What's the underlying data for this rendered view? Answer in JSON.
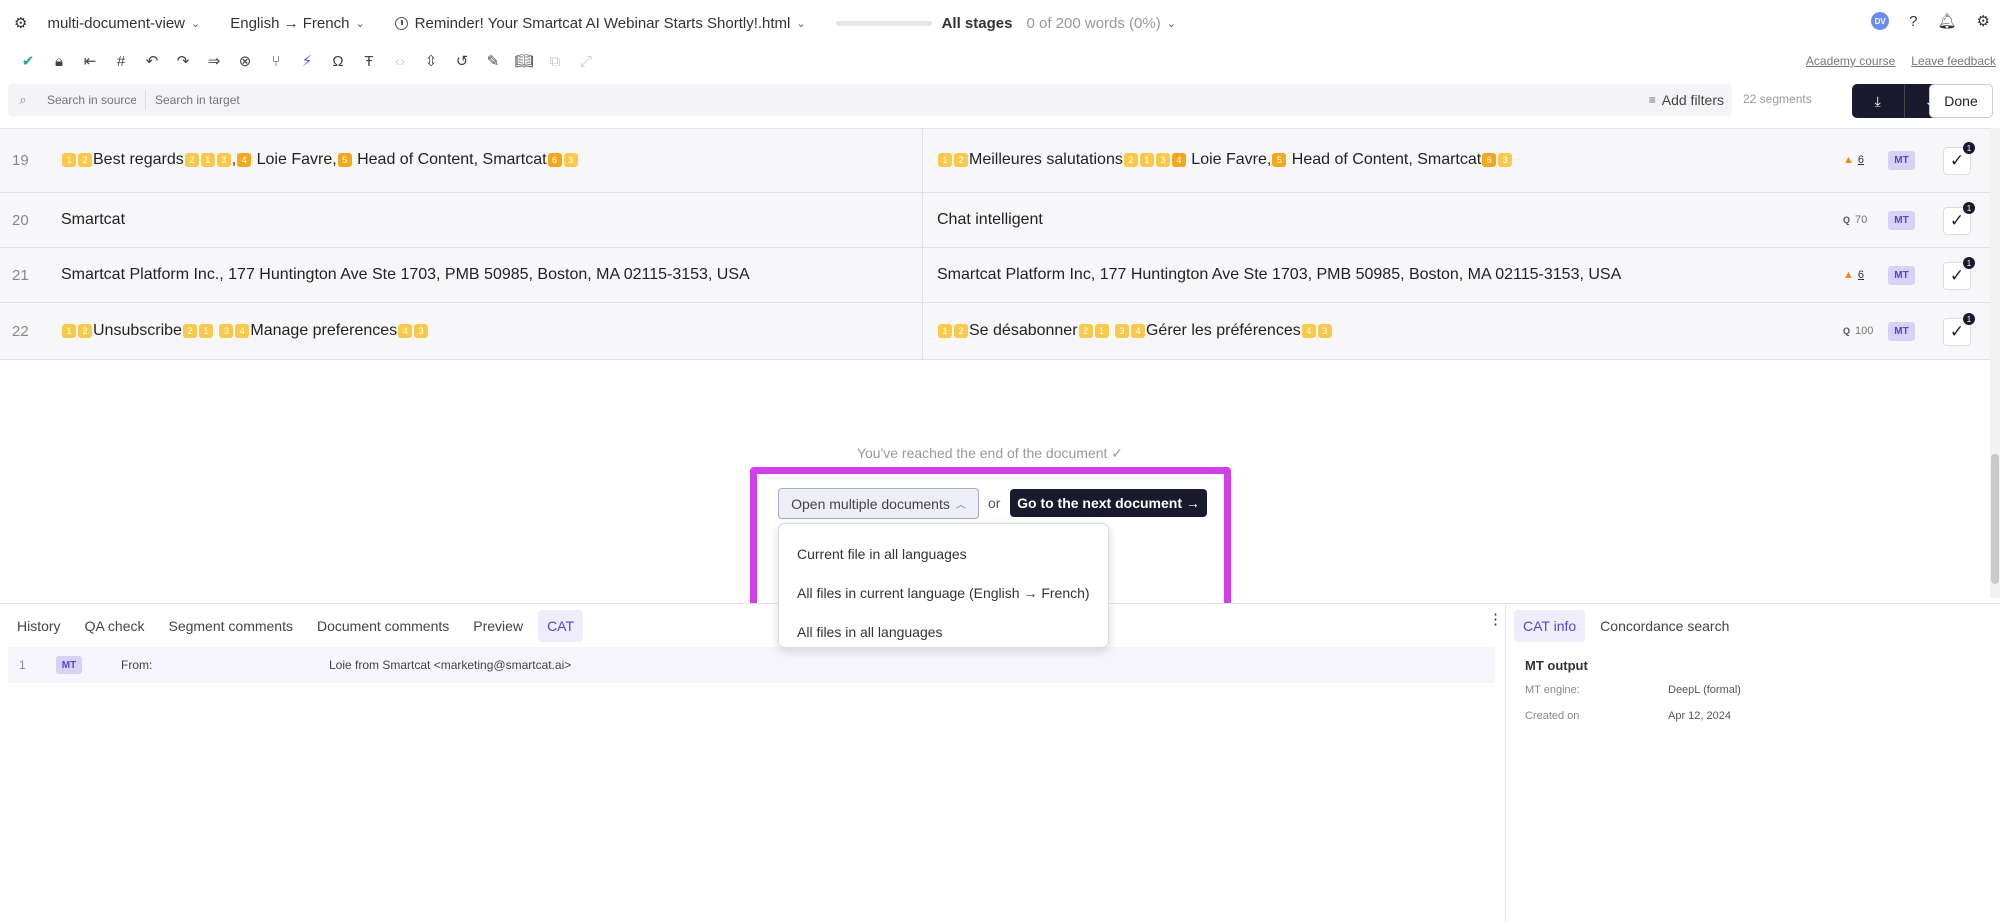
{
  "topbar": {
    "project": "multi-document-view",
    "language_pair": "English → French",
    "document": "Reminder! Your Smartcat AI Webinar Starts Shortly!.html",
    "stage": "All stages",
    "progress": "0 of 200 words  (0%)",
    "progress_fraction": 0,
    "avatar": "DV"
  },
  "toolbar": {
    "links": [
      "Academy course",
      "Leave feedback"
    ]
  },
  "search": {
    "source_placeholder": "Search in source",
    "target_placeholder": "Search in target",
    "add_filters": "Add filters",
    "segments_count": "22 segments",
    "done": "Done"
  },
  "segments": [
    {
      "num": "19",
      "source_parts": [
        {
          "tag": "1"
        },
        {
          "tag": "2"
        },
        {
          "text": "Best regards"
        },
        {
          "tag": "2"
        },
        {
          "tag": "1"
        },
        {
          "tag": "3"
        },
        {
          "text": ","
        },
        {
          "tag": "4",
          "dark": true
        },
        {
          "text": " Loie Favre,"
        },
        {
          "tag": "5",
          "dark": true
        },
        {
          "text": " Head of Content, Smartcat"
        },
        {
          "tag": "6",
          "dark": true
        },
        {
          "tag": "3"
        }
      ],
      "target_parts": [
        {
          "tag": "1"
        },
        {
          "tag": "2"
        },
        {
          "text": "Meilleures salutations"
        },
        {
          "tag": "2"
        },
        {
          "tag": "1"
        },
        {
          "tag": "3"
        },
        {
          "tag": "4",
          "dark": true
        },
        {
          "text": " Loie Favre,"
        },
        {
          "tag": "5",
          "dark": true
        },
        {
          "text": " Head of Content, Smartcat"
        },
        {
          "tag": "6",
          "dark": true
        },
        {
          "tag": "3"
        }
      ],
      "status_type": "warn",
      "status_value": "6",
      "badge": "MT",
      "check_count": "1"
    },
    {
      "num": "20",
      "source_parts": [
        {
          "text": "Smartcat"
        }
      ],
      "target_parts": [
        {
          "text": "Chat intelligent"
        }
      ],
      "status_type": "q",
      "status_value": "70",
      "badge": "MT",
      "check_count": "1"
    },
    {
      "num": "21",
      "source_parts": [
        {
          "text": "Smartcat Platform Inc., 177 Huntington Ave Ste 1703, PMB 50985, Boston, MA 02115-3153, USA"
        }
      ],
      "target_parts": [
        {
          "text": "Smartcat Platform Inc, 177 Huntington Ave Ste 1703, PMB 50985, Boston, MA 02115-3153, USA"
        }
      ],
      "status_type": "warn",
      "status_value": "6",
      "badge": "MT",
      "check_count": "1"
    },
    {
      "num": "22",
      "source_parts": [
        {
          "tag": "1"
        },
        {
          "tag": "2"
        },
        {
          "text": "Unsubscribe"
        },
        {
          "tag": "2"
        },
        {
          "tag": "1"
        },
        {
          "text": " "
        },
        {
          "tag": "3"
        },
        {
          "tag": "4"
        },
        {
          "text": "Manage preferences"
        },
        {
          "tag": "4"
        },
        {
          "tag": "3"
        }
      ],
      "target_parts": [
        {
          "tag": "1"
        },
        {
          "tag": "2"
        },
        {
          "text": "Se désabonner"
        },
        {
          "tag": "2"
        },
        {
          "tag": "1"
        },
        {
          "text": " "
        },
        {
          "tag": "3"
        },
        {
          "tag": "4"
        },
        {
          "text": "Gérer les préférences"
        },
        {
          "tag": "4"
        },
        {
          "tag": "3"
        }
      ],
      "status_type": "q",
      "status_value": "100",
      "badge": "MT",
      "check_count": "1"
    }
  ],
  "end_of_doc": {
    "message": "You've reached the end of the document ✓",
    "open_multiple": "Open multiple documents",
    "or": "or",
    "next_doc": "Go to the next document →",
    "options": [
      "Current file in all languages",
      "All files in current language (English → French)",
      "All files in all languages"
    ]
  },
  "bottom_tabs": [
    "History",
    "QA check",
    "Segment comments",
    "Document comments",
    "Preview",
    "CAT"
  ],
  "bottom_active_tab": "CAT",
  "history_row": {
    "num": "1",
    "badge": "MT",
    "from_label": "From:",
    "from_value": "Loie from Smartcat <marketing@smartcat.ai>"
  },
  "right_tabs": [
    "CAT info",
    "Concordance search"
  ],
  "cat_info": {
    "title": "MT output",
    "rows": [
      {
        "key": "MT engine:",
        "value": "DeepL (formal)"
      },
      {
        "key": "Created on",
        "value": "Apr 12, 2024"
      }
    ]
  },
  "colors": {
    "accent": "#5b45c8",
    "highlight": "#d23fea",
    "tag": "#f8c94a",
    "dark_button": "#1a1a2e"
  }
}
